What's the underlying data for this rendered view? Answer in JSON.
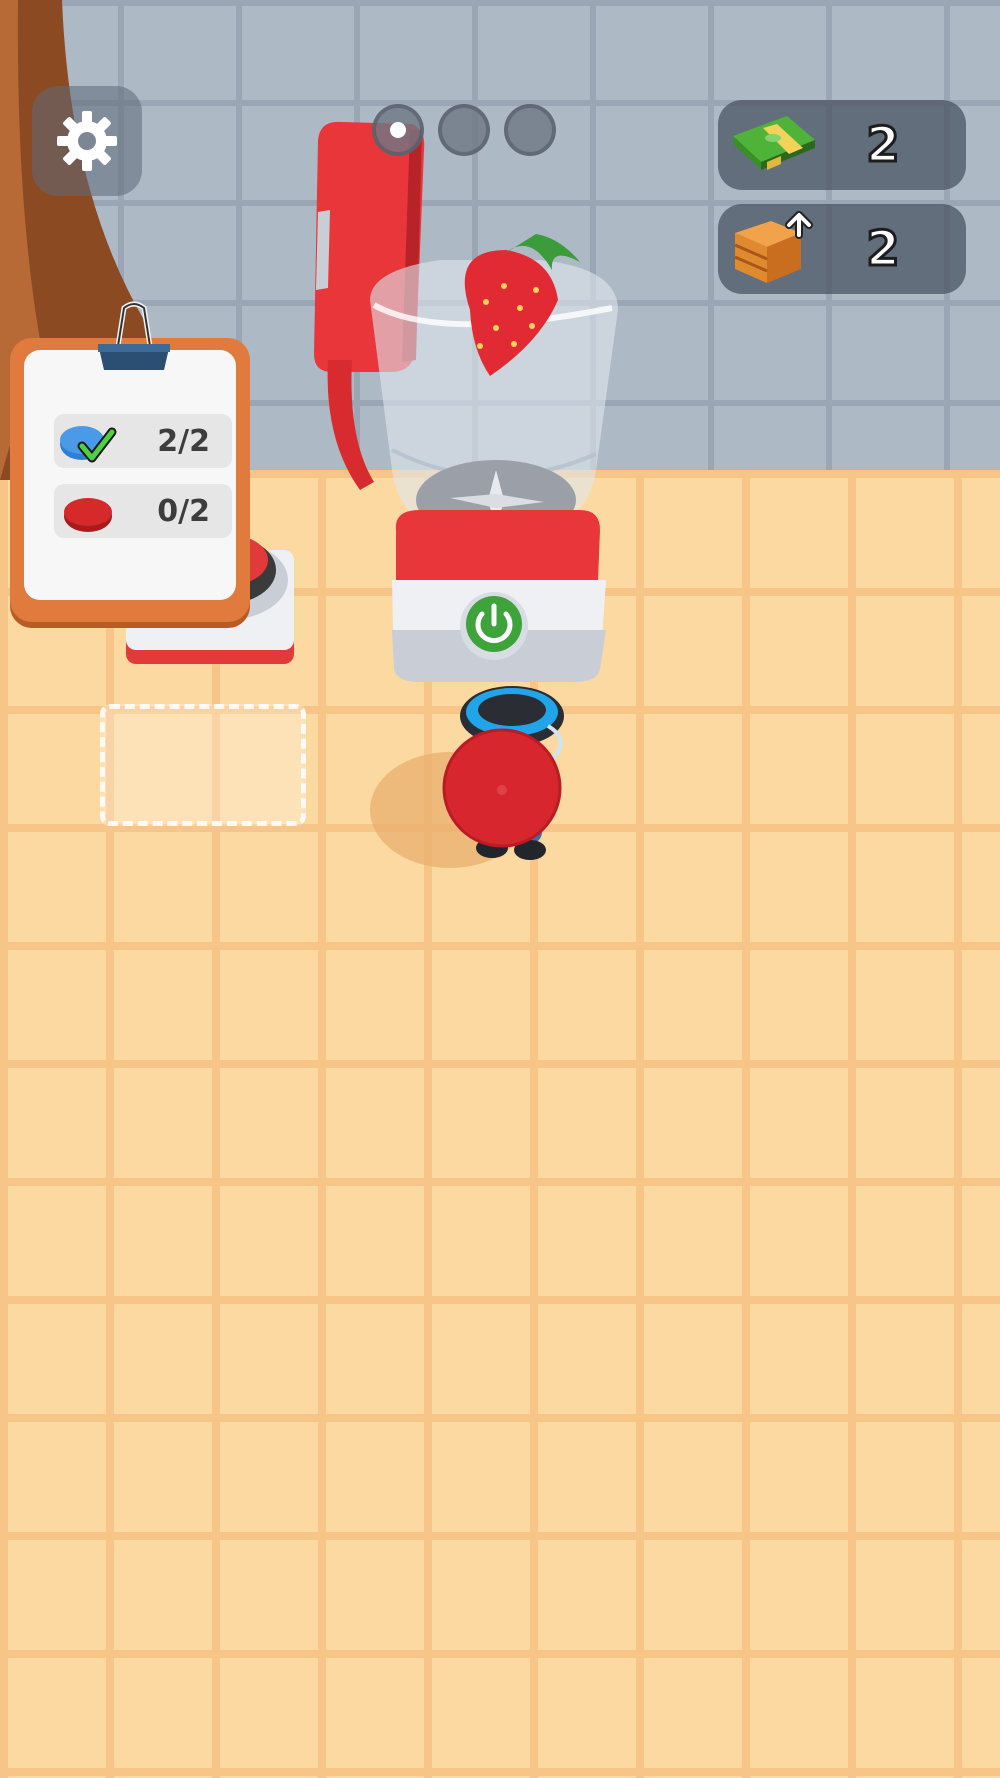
{
  "hud": {
    "settings_icon": "gear-icon",
    "level_progress": {
      "total_stages": 3,
      "current_stage": 1
    },
    "cash": {
      "icon": "cash-stack-icon",
      "value": "2"
    },
    "crates": {
      "icon": "crate-upgrade-icon",
      "value": "2"
    }
  },
  "order_board": {
    "items": [
      {
        "icon": "blue-disc-check-icon",
        "progress": "2/2",
        "color": "#2f7fd6",
        "done": true
      },
      {
        "icon": "red-disc-icon",
        "progress": "0/2",
        "color": "#d62a2a",
        "done": false
      }
    ]
  },
  "blender": {
    "power_icon": "power-icon",
    "fruit": "strawberry-icon",
    "colors": {
      "body": "#e8363a",
      "base": "#eef0f3",
      "button": "#3ea33a"
    }
  },
  "player": {
    "hat_color": "#d8262e",
    "stack_color": "#20a6e8"
  }
}
